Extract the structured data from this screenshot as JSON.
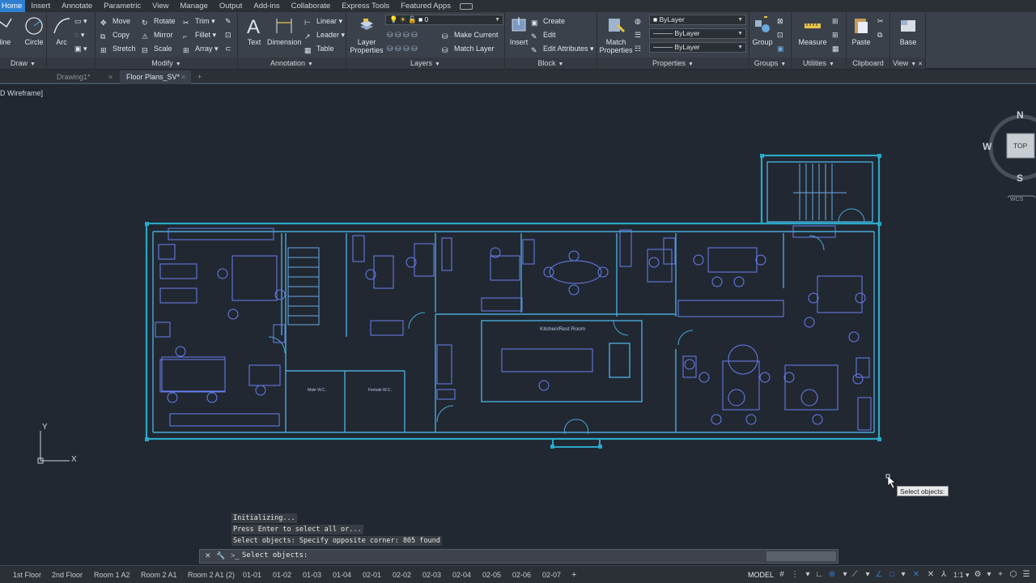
{
  "ribbon_tabs": [
    "Home",
    "Insert",
    "Annotate",
    "Parametric",
    "View",
    "Manage",
    "Output",
    "Add-ins",
    "Collaborate",
    "Express Tools",
    "Featured Apps"
  ],
  "ribbon": {
    "draw": {
      "title": "Draw",
      "polyline": "yline",
      "circle": "Circle",
      "arc": "Arc"
    },
    "modify": {
      "title": "Modify",
      "move": "Move",
      "rotate": "Rotate",
      "trim": "Trim",
      "copy": "Copy",
      "mirror": "Mirror",
      "fillet": "Fillet",
      "stretch": "Stretch",
      "scale": "Scale",
      "array": "Array"
    },
    "annotation": {
      "title": "Annotation",
      "text": "Text",
      "dimension": "Dimension",
      "linear": "Linear",
      "leader": "Leader",
      "table": "Table"
    },
    "layers": {
      "title": "Layers",
      "layer_properties_1": "Layer",
      "layer_properties_2": "Properties",
      "current_layer": "0",
      "make_current": "Make Current",
      "match_layer": "Match Layer"
    },
    "block": {
      "title": "Block",
      "insert": "Insert",
      "create": "Create",
      "edit": "Edit",
      "edit_attributes": "Edit Attributes"
    },
    "properties": {
      "title": "Properties",
      "match_1": "Match",
      "match_2": "Properties",
      "color": "ByLayer",
      "linetype": "ByLayer",
      "lineweight": "ByLayer"
    },
    "groups": {
      "title": "Groups",
      "group": "Group"
    },
    "utilities": {
      "title": "Utilities",
      "measure": "Measure"
    },
    "clipboard": {
      "title": "Clipboard",
      "paste": "Paste"
    },
    "view": {
      "title": "View",
      "base": "Base"
    }
  },
  "file_tabs": [
    {
      "label": "Drawing1*",
      "active": false
    },
    {
      "label": "Floor Plans_SV*",
      "active": true
    }
  ],
  "viewport_label": "D Wireframe]",
  "navcube": {
    "north": "N",
    "west": "W",
    "south": "S",
    "top": "TOP",
    "wcs": "WCS"
  },
  "ucs": {
    "x": "X",
    "y": "Y"
  },
  "floorplan_labels": {
    "kitchen": "Kitchen/Rest Room",
    "male_wc": "Male W.C.",
    "female_wc": "Female W.C."
  },
  "command_history": [
    "Initializing...",
    "Press Enter to select all or...",
    "Select objects: Specify opposite corner: 805 found"
  ],
  "command_prompt": "Select objects:",
  "tooltip": "Select objects:",
  "layout_tabs": [
    "1st Floor",
    "2nd Floor",
    "Room 1 A2",
    "Room 2 A1",
    "Room 2 A1 (2)",
    "01-01",
    "01-02",
    "01-03",
    "01-04",
    "02-01",
    "02-02",
    "02-03",
    "02-04",
    "02-05",
    "02-06",
    "02-07"
  ],
  "status": {
    "model": "MODEL",
    "scale": "1:1"
  },
  "colors": {
    "accent": "#2f7fd0",
    "plan_walls": "#4aa8d8",
    "plan_furniture": "#6a7ff0",
    "selection": "#2ba8c8"
  }
}
